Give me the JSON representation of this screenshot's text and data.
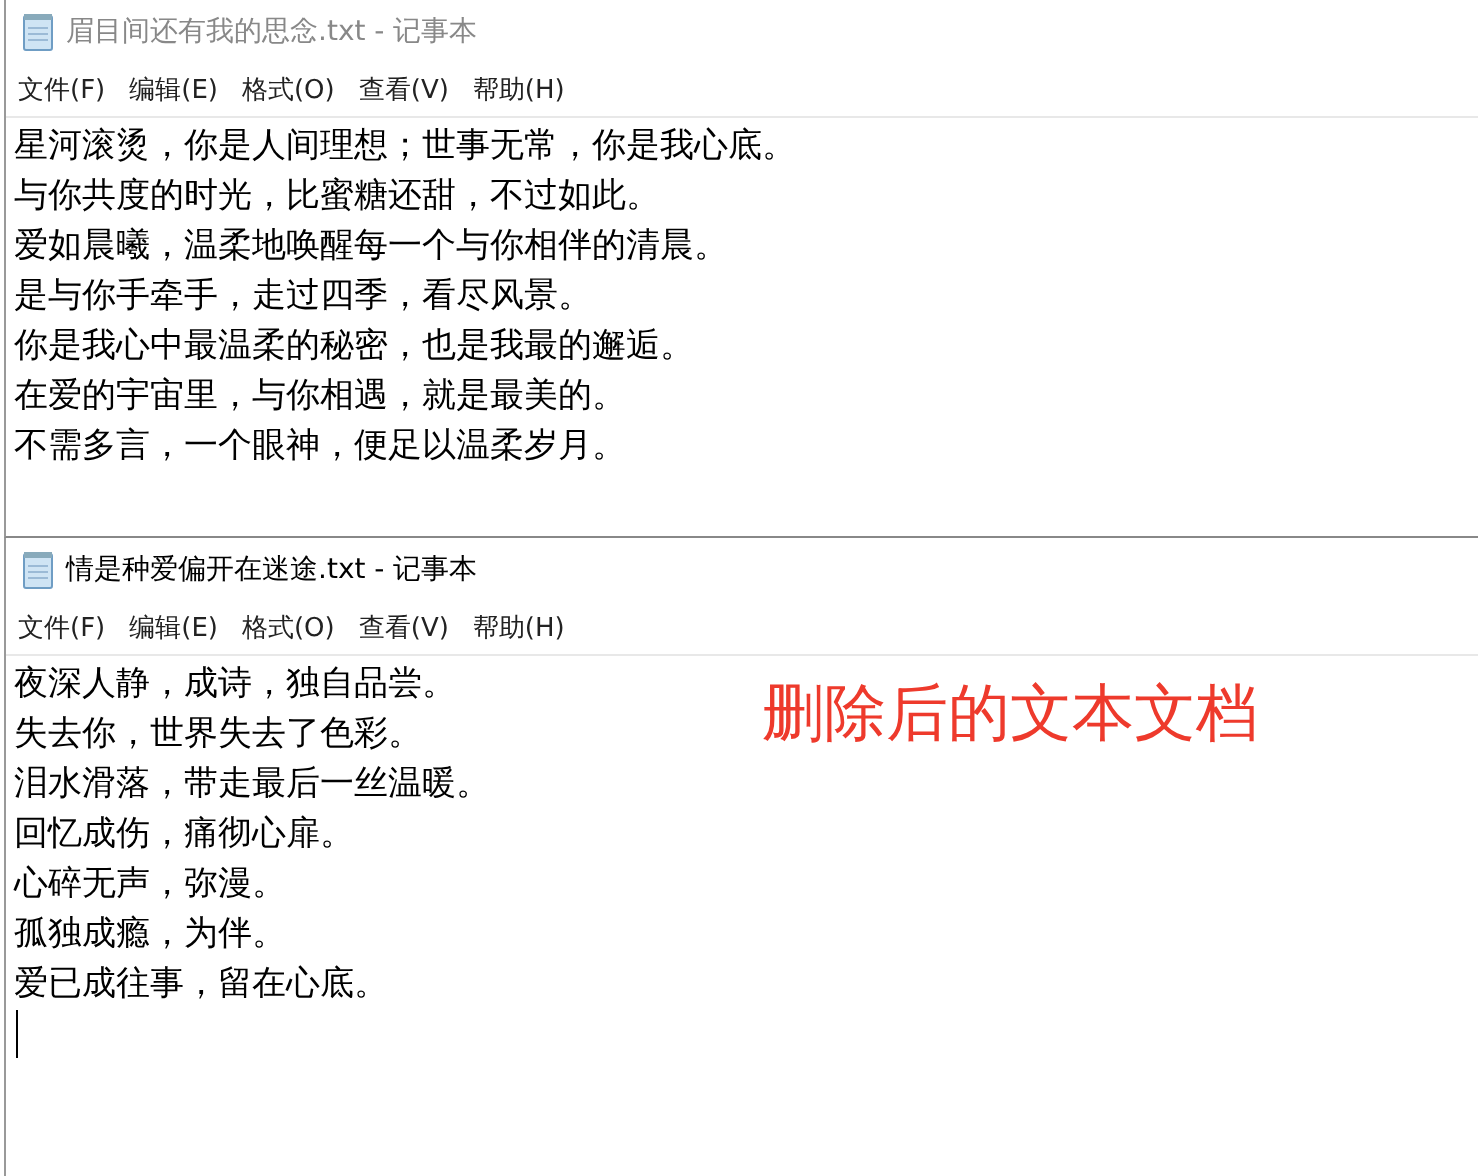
{
  "windows": [
    {
      "title": "眉目间还有我的思念.txt - 记事本",
      "active": false,
      "menu": [
        "文件(F)",
        "编辑(E)",
        "格式(O)",
        "查看(V)",
        "帮助(H)"
      ],
      "lines": [
        "星河滚烫，你是人间理想；世事无常，你是我心底。",
        "与你共度的时光，比蜜糖还甜，不过如此。",
        "爱如晨曦，温柔地唤醒每一个与你相伴的清晨。",
        "是与你手牵手，走过四季，看尽风景。",
        "你是我心中最温柔的秘密，也是我最的邂逅。",
        "在爱的宇宙里，与你相遇，就是最美的。",
        "不需多言，一个眼神，便足以温柔岁月。"
      ]
    },
    {
      "title": "情是种爱偏开在迷途.txt - 记事本",
      "active": true,
      "menu": [
        "文件(F)",
        "编辑(E)",
        "格式(O)",
        "查看(V)",
        "帮助(H)"
      ],
      "lines": [
        "夜深人静，成诗，独自品尝。",
        "失去你，世界失去了色彩。",
        "泪水滑落，带走最后一丝温暖。",
        "回忆成伤，痛彻心扉。",
        "心碎无声，弥漫。",
        "孤独成瘾，为伴。",
        "爱已成往事，留在心底。"
      ],
      "annotation": "删除后的文本文档"
    }
  ]
}
